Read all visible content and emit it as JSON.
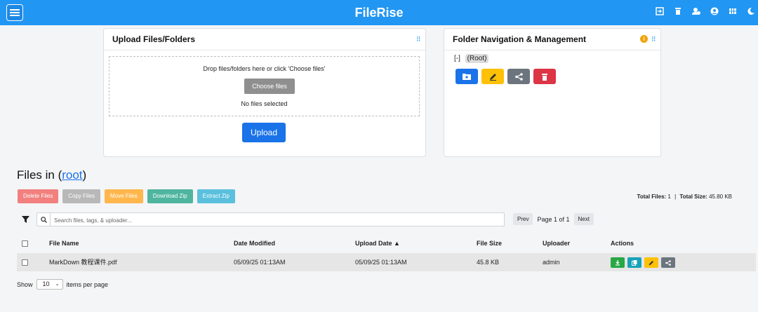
{
  "app": {
    "title": "FileRise"
  },
  "upload": {
    "title": "Upload Files/Folders",
    "drop_text": "Drop files/folders here or click 'Choose files'",
    "choose_label": "Choose files",
    "no_files": "No files selected",
    "upload_label": "Upload"
  },
  "folder": {
    "title": "Folder Navigation & Management",
    "tree_toggle": "[-]",
    "root_label": "(Root)"
  },
  "files": {
    "heading_prefix": "Files in (",
    "heading_link": "root",
    "heading_suffix": ")",
    "bulk": {
      "delete": "Delete Files",
      "copy": "Copy Files",
      "move": "Move Files",
      "download_zip": "Download Zip",
      "extract_zip": "Extract Zip"
    },
    "totals": {
      "files_label": "Total Files:",
      "files_value": "1",
      "separator": "|",
      "size_label": "Total Size:",
      "size_value": "45.80 KB"
    },
    "search": {
      "placeholder": "Search files, tags, & uploader..."
    },
    "pager": {
      "prev": "Prev",
      "page_text": "Page 1 of 1",
      "next": "Next"
    },
    "columns": {
      "name": "File Name",
      "modified": "Date Modified",
      "uploaded": "Upload Date ▲",
      "size": "File Size",
      "uploader": "Uploader",
      "actions": "Actions"
    },
    "rows": [
      {
        "name": "MarkDown 教程课件.pdf",
        "modified": "05/09/25 01:13AM",
        "uploaded": "05/09/25 01:13AM",
        "size": "45.8 KB",
        "uploader": "admin"
      }
    ],
    "per_page": {
      "prefix": "Show",
      "value": "10",
      "suffix": "items per page"
    }
  },
  "colors": {
    "topbar": "#2196f3",
    "primary": "#1a73e8",
    "warning": "#ffc107",
    "danger": "#dc3545",
    "secondary": "#6c757d",
    "success": "#28a745",
    "info": "#17a2b8"
  },
  "icons": {
    "top_right": [
      "logout-icon",
      "trash-icon",
      "user-add-icon",
      "user-icon",
      "grid-icon",
      "moon-icon"
    ],
    "folder_actions": [
      "create-folder-icon",
      "rename-icon",
      "share-icon",
      "delete-icon"
    ],
    "row_actions": [
      "download-icon",
      "copy-icon",
      "edit-icon",
      "share-icon"
    ]
  }
}
